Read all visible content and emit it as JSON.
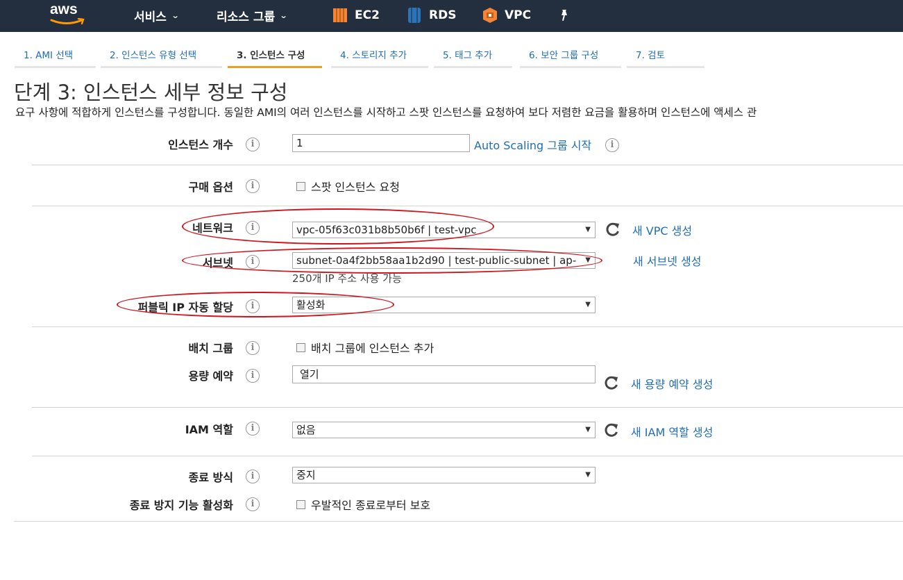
{
  "topnav": {
    "logo": "aws",
    "services": "서비스",
    "resource_groups": "리소스 그룹",
    "shortcuts": [
      {
        "label": "EC2",
        "icon": "ec2-icon",
        "color": "#f58536"
      },
      {
        "label": "RDS",
        "icon": "rds-icon",
        "color": "#2e73b8"
      },
      {
        "label": "VPC",
        "icon": "vpc-icon",
        "color": "#f58536"
      }
    ],
    "pin_icon": "pushpin-icon"
  },
  "steps": [
    {
      "label": "1. AMI 선택"
    },
    {
      "label": "2. 인스턴스 유형 선택"
    },
    {
      "label": "3. 인스턴스 구성",
      "active": true
    },
    {
      "label": "4. 스토리지 추가"
    },
    {
      "label": "5. 태그 추가"
    },
    {
      "label": "6. 보안 그룹 구성"
    },
    {
      "label": "7. 검토"
    }
  ],
  "page": {
    "title": "단계 3: 인스턴스 세부 정보 구성",
    "description": "요구 사항에 적합하게 인스턴스를 구성합니다. 동일한 AMI의 여러 인스턴스를 시작하고 스팟 인스턴스를 요청하여 보다 저렴한 요금을 활용하며 인스턴스에 액세스 관"
  },
  "form": {
    "instance_count": {
      "label": "인스턴스 개수",
      "value": "1",
      "link": "Auto Scaling 그룹 시작"
    },
    "purchase_option": {
      "label": "구매 옵션",
      "checkbox": "스팟 인스턴스 요청",
      "checked": false
    },
    "network": {
      "label": "네트워크",
      "value": "vpc-05f63c031b8b50b6f | test-vpc",
      "link": "새 VPC 생성"
    },
    "subnet": {
      "label": "서브넷",
      "value": "subnet-0a4f2bb58aa1b2d90 | test-public-subnet | ap-",
      "link": "새 서브넷 생성",
      "note": "250개 IP 주소 사용 가능"
    },
    "public_ip": {
      "label": "퍼블릭 IP 자동 할당",
      "value": "활성화"
    },
    "placement_group": {
      "label": "배치 그룹",
      "checkbox": "배치 그룹에 인스턴스 추가",
      "checked": false
    },
    "capacity_reservation": {
      "label": "용량 예약",
      "value": "열기",
      "link": "새 용량 예약 생성"
    },
    "iam_role": {
      "label": "IAM 역할",
      "value": "없음",
      "link": "새 IAM 역할 생성"
    },
    "shutdown_behavior": {
      "label": "종료 방식",
      "value": "중지"
    },
    "termination_protection": {
      "label": "종료 방지 기능 활성화",
      "checkbox": "우발적인 종료로부터 보호",
      "checked": false
    }
  },
  "info_glyph": "i",
  "select_arrow": "▼",
  "annotation_color": "#d0151e"
}
